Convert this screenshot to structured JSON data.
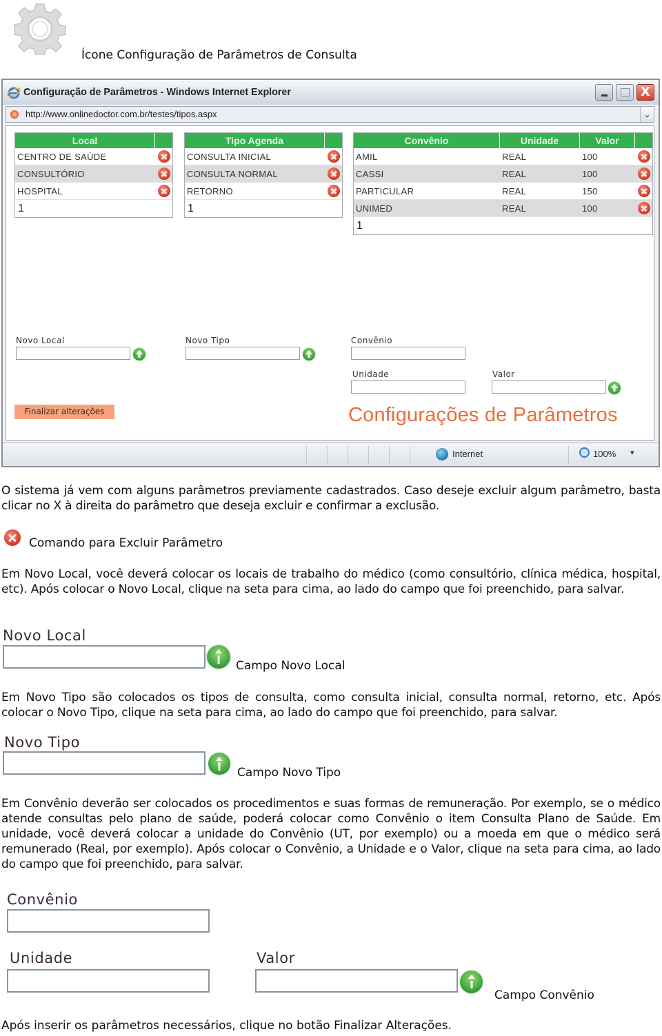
{
  "header": {
    "gear_icon": "gear-icon",
    "caption": "Ícone Configuração de Parâmetros de Consulta"
  },
  "browser": {
    "title": "Configuração de Parâmetros - Windows Internet Explorer",
    "url": "http://www.onlinedoctor.com.br/testes/tipos.aspx",
    "close_label": "X",
    "address_dropdown": "⌄",
    "status_zone": "Internet",
    "zoom_level": "100%",
    "zoom_dropdown": "▾"
  },
  "app": {
    "local_grid": {
      "header": "Local",
      "rows": [
        "CENTRO DE SAÚDE",
        "CONSULTÓRIO",
        "HOSPITAL"
      ],
      "pager": "1"
    },
    "tipo_grid": {
      "header": "Tipo Agenda",
      "rows": [
        "CONSULTA INICIAL",
        "CONSULTA NORMAL",
        "RETORNO"
      ],
      "pager": "1"
    },
    "convenio_grid": {
      "headers": [
        "Convênio",
        "Unidade",
        "Valor"
      ],
      "rows": [
        {
          "convenio": "AMIL",
          "unidade": "REAL",
          "valor": "100"
        },
        {
          "convenio": "CASSI",
          "unidade": "REAL",
          "valor": "100"
        },
        {
          "convenio": "PARTICULAR",
          "unidade": "REAL",
          "valor": "150"
        },
        {
          "convenio": "UNIMED",
          "unidade": "REAL",
          "valor": "100"
        }
      ],
      "pager": "1"
    },
    "form": {
      "novo_local_label": "Novo Local",
      "novo_local_value": "",
      "novo_tipo_label": "Novo Tipo",
      "novo_tipo_value": "",
      "convenio_label": "Convênio",
      "convenio_value": "",
      "unidade_label": "Unidade",
      "unidade_value": "",
      "valor_label": "Valor",
      "valor_value": ""
    },
    "finalize_button": "Finalizar alterações",
    "brand_title": "Configurações de Parâmetros"
  },
  "doc": {
    "para1": "O sistema já vem com alguns parâmetros previamente cadastrados. Caso deseje excluir algum parâmetro, basta clicar no X à direita do parâmetro que deseja excluir e confirmar a exclusão.",
    "delete_caption": "Comando para Excluir Parâmetro",
    "para2": "Em Novo Local, você deverá colocar os locais de trabalho do médico (como consultório, clínica médica, hospital, etc). Após colocar o Novo Local, clique na seta para cima, ao lado do campo que foi preenchido, para salvar.",
    "novo_local_label": "Novo Local",
    "novo_local_caption": "Campo Novo Local",
    "para3": "Em Novo Tipo são colocados os tipos de consulta, como consulta inicial, consulta normal, retorno, etc. Após colocar o Novo Tipo, clique na seta para cima, ao lado do campo que foi preenchido, para salvar.",
    "novo_tipo_label": "Novo Tipo",
    "novo_tipo_caption": "Campo Novo Tipo",
    "para4": "Em Convênio deverão ser colocados os procedimentos e suas formas de remuneração. Por exemplo, se o médico atende consultas pelo plano de saúde, poderá colocar como Convênio o item Consulta Plano de Saúde. Em unidade, você deverá colocar a unidade do Convênio (UT, por exemplo) ou a moeda em que o médico será remunerado (Real, por exemplo). Após colocar o Convênio, a Unidade e o Valor, clique na seta para cima, ao lado do campo que foi preenchido, para salvar.",
    "convenio_label": "Convênio",
    "unidade_label": "Unidade",
    "valor_label": "Valor",
    "convenio_caption": "Campo Convênio",
    "para5": "Após inserir os parâmetros necessários, clique no botão Finalizar Alterações."
  },
  "colors": {
    "grid_header": "#35b24f",
    "delete_red": "#d53e2c",
    "brand_orange": "#ea6c3d",
    "finalize_bg": "#f5a27d",
    "save_green": "#3a9b3a"
  }
}
